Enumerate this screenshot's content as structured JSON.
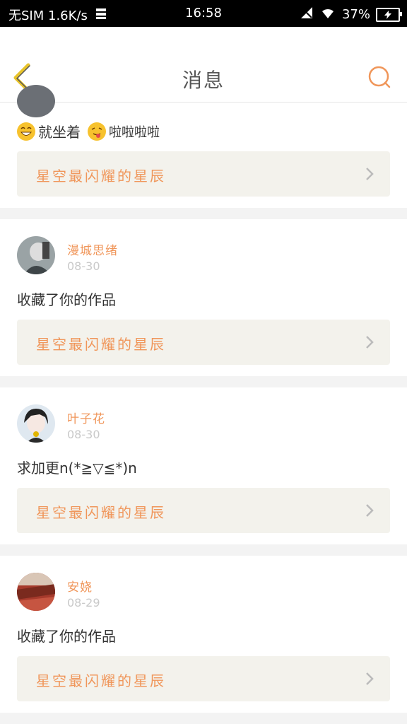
{
  "status_bar": {
    "carrier": "无SIM 1.6K/s",
    "time": "16:58",
    "battery": "37%"
  },
  "header": {
    "title": "消息"
  },
  "messages": [
    {
      "text": "就坐着",
      "text2": "啦啦啦啦",
      "work_title": "星空最闪耀的星辰"
    },
    {
      "username": "漫城思绪",
      "date": "08-30",
      "text": "收藏了你的作品",
      "work_title": "星空最闪耀的星辰"
    },
    {
      "username": "叶子花",
      "date": "08-30",
      "text": "求加更n(*≧▽≦*)n",
      "work_title": "星空最闪耀的星辰"
    },
    {
      "username": "安娆",
      "date": "08-29",
      "text": "收藏了你的作品",
      "work_title": "星空最闪耀的星辰"
    }
  ],
  "colors": {
    "accent": "#f0965a",
    "back_icon": "#e8c32a",
    "card_button_bg": "#f3f2ec"
  }
}
